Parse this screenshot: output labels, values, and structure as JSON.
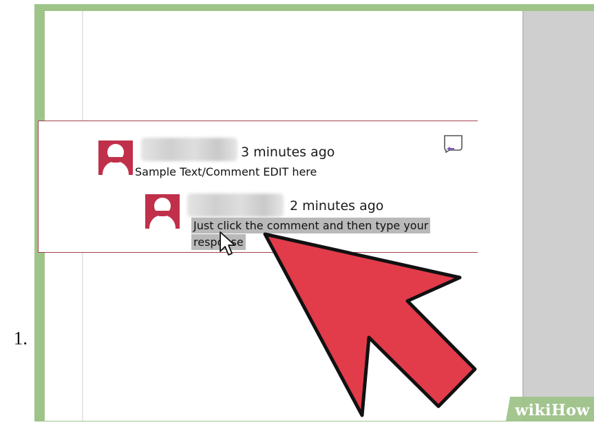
{
  "step": {
    "number": "1."
  },
  "comment": {
    "timestamp": "3 minutes ago",
    "text": "Sample Text/Comment EDIT here",
    "icon": "reply-comment-icon"
  },
  "reply": {
    "timestamp": "2 minutes ago",
    "text_line1": "Just click the comment and then type your",
    "text_line2": "response"
  },
  "watermark": {
    "prefix": "wiki",
    "suffix": "How"
  },
  "colors": {
    "frame": "#9fc48a",
    "comment_accent": "#a04050",
    "avatar": "#c0304a",
    "arrow": "#e23b4a",
    "side_panel": "#cfcfcf"
  }
}
